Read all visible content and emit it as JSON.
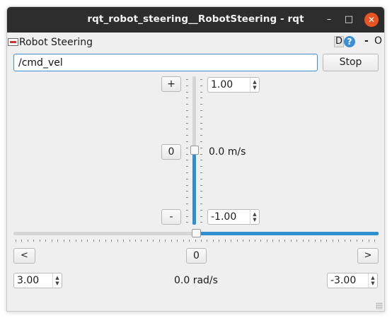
{
  "window": {
    "title": "rqt_robot_steering__RobotSteering - rqt",
    "minimize_glyph": "–",
    "maximize_glyph": "□",
    "close_glyph": "✕"
  },
  "plugin": {
    "title": "Robot Steering",
    "d_label": "D",
    "help_glyph": "?",
    "dash_label": "-",
    "o_label": "O"
  },
  "topic": {
    "value": "/cmd_vel"
  },
  "stop_label": "Stop",
  "linear": {
    "plus_label": "+",
    "zero_label": "0",
    "minus_label": "-",
    "max_value": "1.00",
    "min_value": "-1.00",
    "speed_text": "0.0 m/s",
    "slider_fraction": 0.5
  },
  "angular": {
    "left_label": "<",
    "zero_label": "0",
    "right_label": ">",
    "max_value": "3.00",
    "min_value": "-3.00",
    "speed_text": "0.0 rad/s",
    "slider_fraction": 0.5
  },
  "spin_up_glyph": "▲",
  "spin_down_glyph": "▼",
  "colors": {
    "accent": "#2f8fcf",
    "titlebar": "#2d2d2d",
    "close_button": "#e95420",
    "background": "#efefef"
  }
}
